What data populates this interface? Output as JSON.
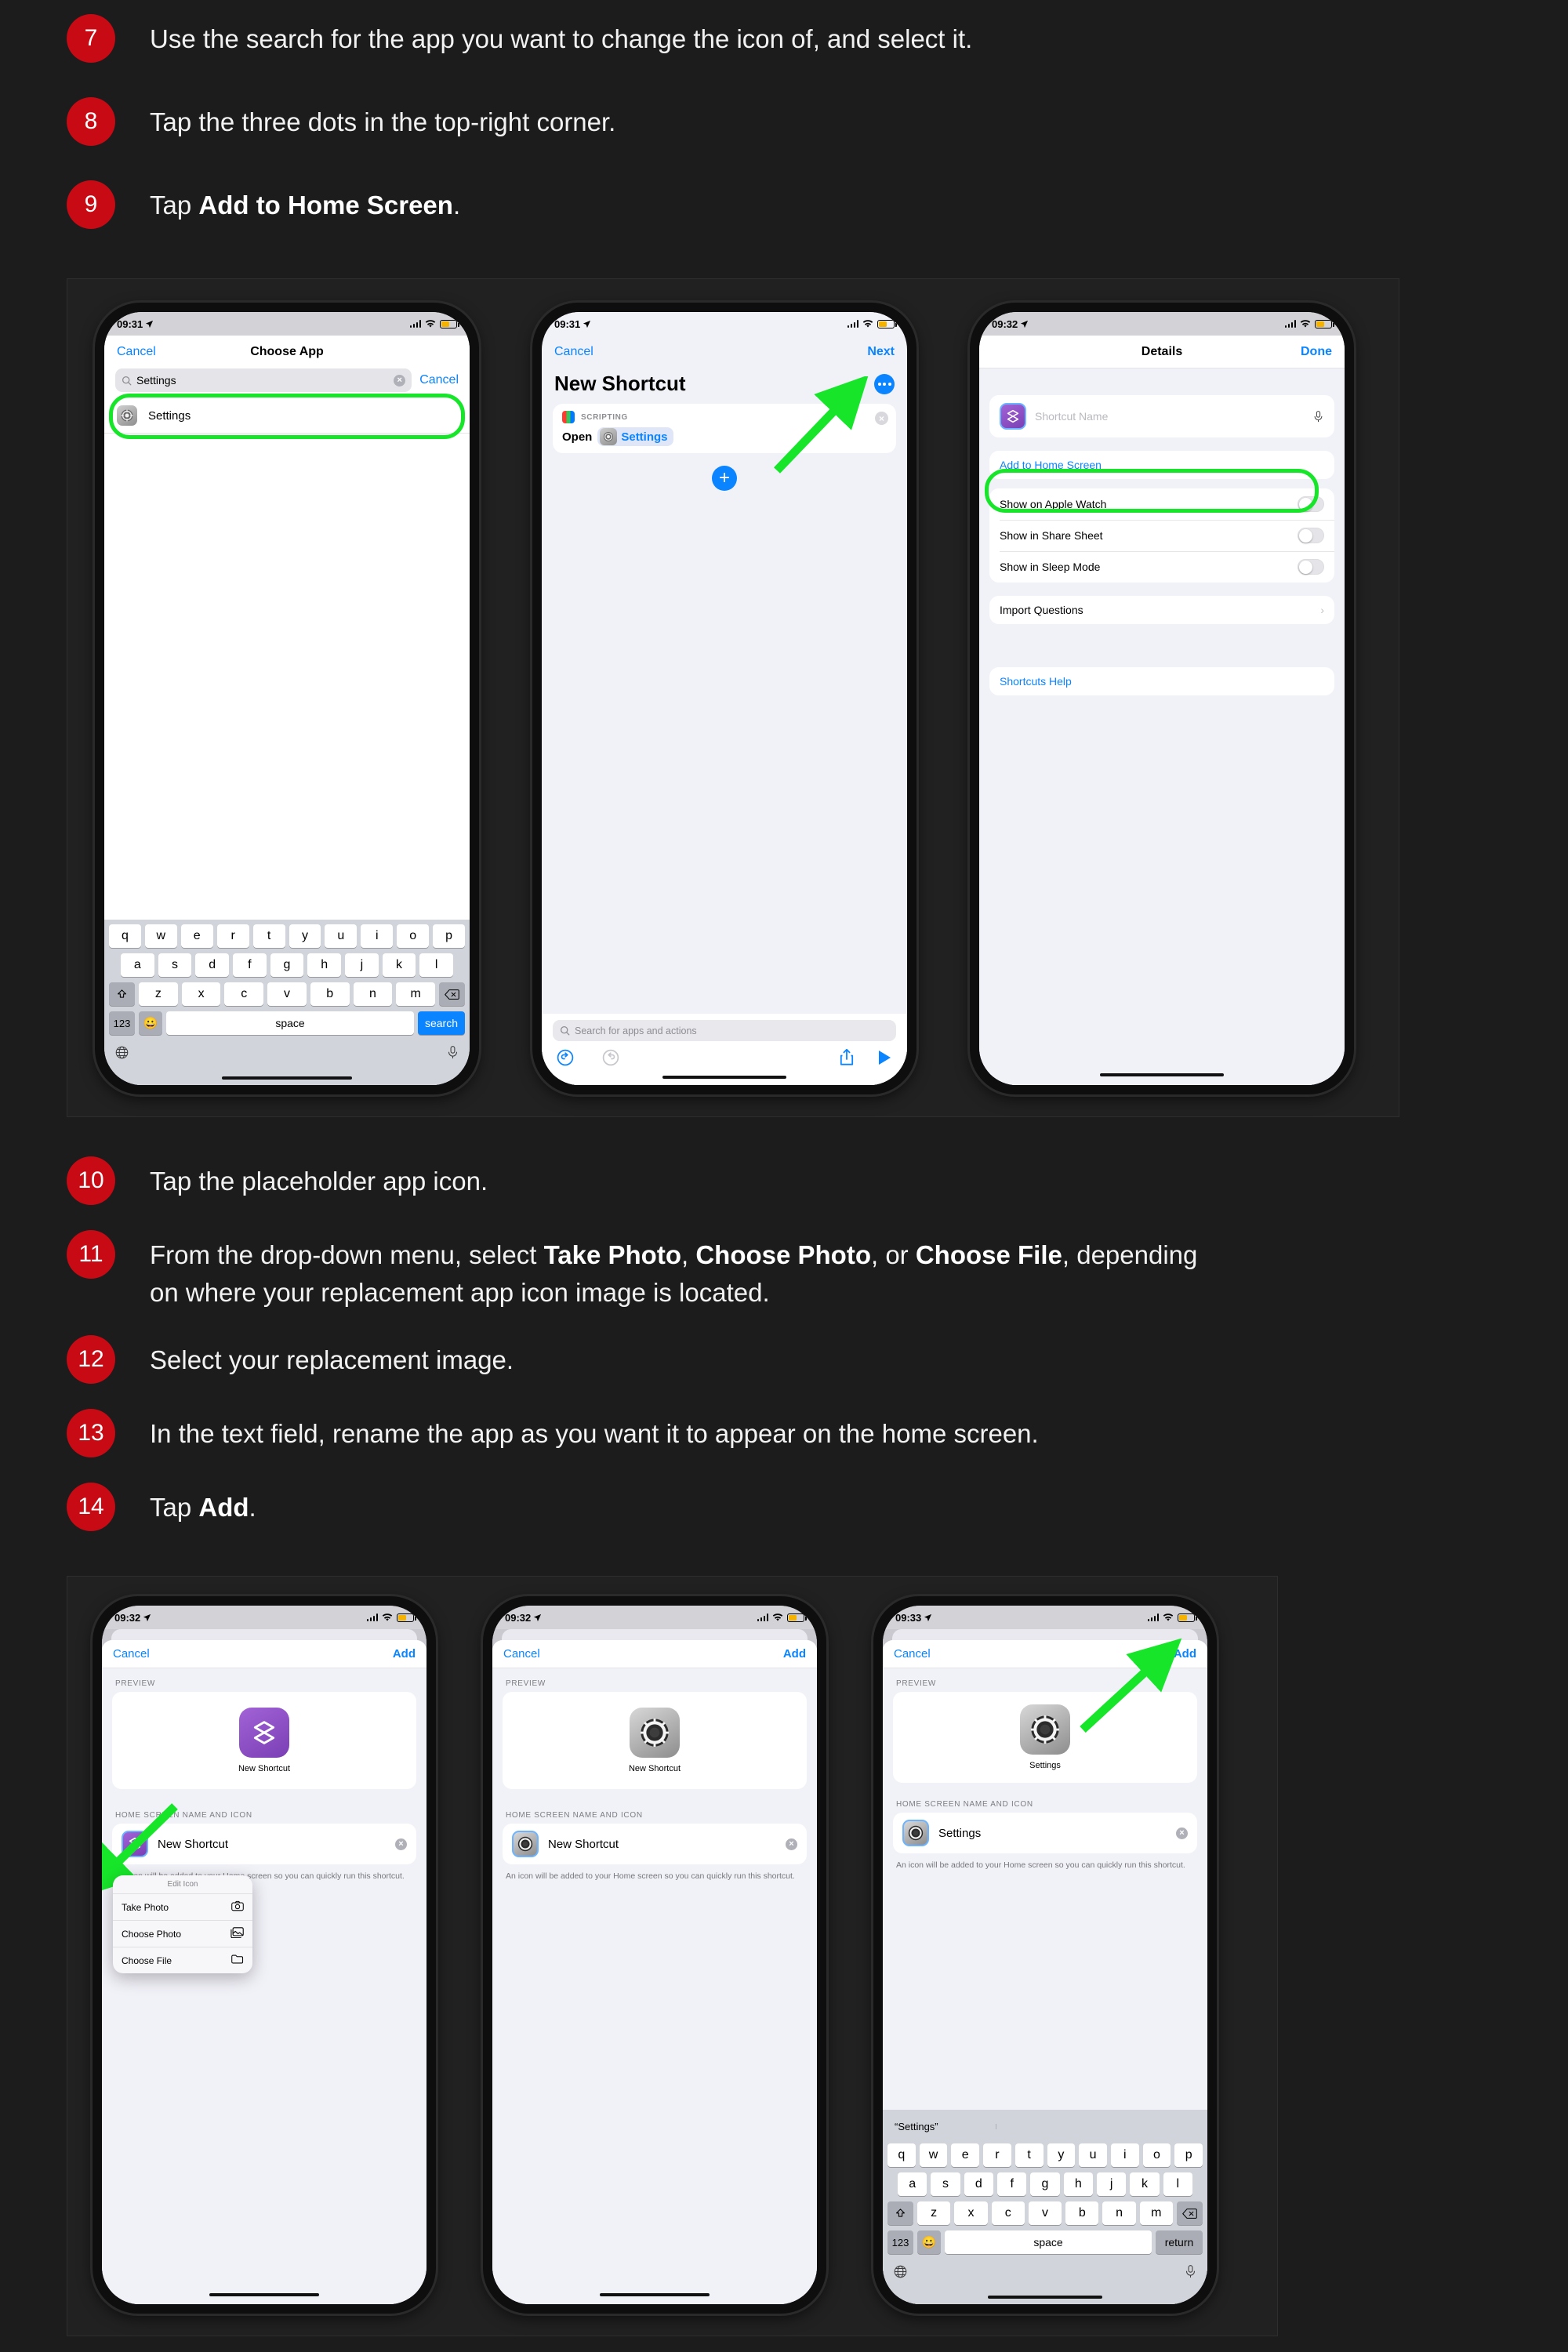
{
  "steps_top": [
    {
      "num": "7",
      "parts": [
        {
          "t": "Use the search for the app you want to change the icon of, and select it.",
          "b": false
        }
      ]
    },
    {
      "num": "8",
      "parts": [
        {
          "t": "Tap the three dots in the top-right corner.",
          "b": false
        }
      ]
    },
    {
      "num": "9",
      "parts": [
        {
          "t": "Tap ",
          "b": false
        },
        {
          "t": "Add to Home Screen",
          "b": true
        },
        {
          "t": ".",
          "b": false
        }
      ]
    }
  ],
  "steps_bottom": [
    {
      "num": "10",
      "parts": [
        {
          "t": "Tap the placeholder app icon.",
          "b": false
        }
      ]
    },
    {
      "num": "11",
      "parts": [
        {
          "t": "From the drop-down menu, select ",
          "b": false
        },
        {
          "t": "Take Photo",
          "b": true
        },
        {
          "t": ", ",
          "b": false
        },
        {
          "t": "Choose Photo",
          "b": true
        },
        {
          "t": ", or ",
          "b": false
        },
        {
          "t": "Choose File",
          "b": true
        },
        {
          "t": ", depending on where your replacement app icon image is located.",
          "b": false
        }
      ]
    },
    {
      "num": "12",
      "parts": [
        {
          "t": "Select your replacement image.",
          "b": false
        }
      ]
    },
    {
      "num": "13",
      "parts": [
        {
          "t": "In the text field, rename the app as you want it to appear on the home screen.",
          "b": false
        }
      ]
    },
    {
      "num": "14",
      "parts": [
        {
          "t": "Tap ",
          "b": false
        },
        {
          "t": "Add",
          "b": true
        },
        {
          "t": ".",
          "b": false
        }
      ]
    }
  ],
  "colors": {
    "badge_red": "#c80a14",
    "ios_blue": "#0a84ff",
    "highlight_green": "#17e52a",
    "page_bg": "#1c1c1c",
    "group_bg": "#212121"
  },
  "phone1": {
    "status": {
      "time": "09:31",
      "battery": "55"
    },
    "nav": {
      "cancel": "Cancel",
      "title": "Choose App"
    },
    "search": {
      "value": "Settings",
      "cancel": "Cancel",
      "clear_icon": "clear-circle-icon",
      "search_icon": "search-icon"
    },
    "result": {
      "label": "Settings",
      "icon": "settings-gear-icon"
    },
    "keyboard": {
      "row1": [
        "q",
        "w",
        "e",
        "r",
        "t",
        "y",
        "u",
        "i",
        "o",
        "p"
      ],
      "row2": [
        "a",
        "s",
        "d",
        "f",
        "g",
        "h",
        "j",
        "k",
        "l"
      ],
      "row3": [
        "z",
        "x",
        "c",
        "v",
        "b",
        "n",
        "m"
      ],
      "shift": "shift-icon",
      "backspace": "backspace-icon",
      "num": "123",
      "emoji": "emoji-icon",
      "space": "space",
      "action": "search",
      "globe": "globe-icon",
      "mic": "microphone-icon"
    }
  },
  "phone2": {
    "status": {
      "time": "09:31",
      "battery": "55"
    },
    "nav": {
      "cancel": "Cancel",
      "next": "Next"
    },
    "title": "New Shortcut",
    "more_button": "more-dots-icon",
    "action_card": {
      "category": "SCRIPTING",
      "verb": "Open",
      "token": "Settings",
      "close": "close-circle-icon"
    },
    "add_action_button": "plus-icon",
    "bottom_search_placeholder": "Search for apps and actions",
    "toolbar": {
      "undo": "undo-icon",
      "redo": "redo-icon",
      "share": "share-icon",
      "play": "play-icon"
    }
  },
  "phone3": {
    "status": {
      "time": "09:32",
      "battery": "55"
    },
    "nav": {
      "title": "Details",
      "done": "Done"
    },
    "name_field": {
      "placeholder": "Shortcut Name",
      "icon": "shortcut-layers-icon",
      "mic": "microphone-icon"
    },
    "add_to_home": "Add to Home Screen",
    "toggles": [
      {
        "label": "Show on Apple Watch",
        "on": false
      },
      {
        "label": "Show in Share Sheet",
        "on": false
      },
      {
        "label": "Show in Sleep Mode",
        "on": false
      }
    ],
    "import_questions": {
      "label": "Import Questions",
      "chevron": "chevron-right-icon"
    },
    "shortcuts_help": "Shortcuts Help"
  },
  "phone4": {
    "status": {
      "time": "09:32",
      "battery": "55"
    },
    "sheet_nav": {
      "cancel": "Cancel",
      "add": "Add"
    },
    "preview_label": "PREVIEW",
    "preview": {
      "name": "New Shortcut",
      "icon": "shortcut-layers-icon"
    },
    "home_label": "HOME SCREEN NAME AND ICON",
    "home_row": {
      "name": "New Shortcut",
      "icon": "shortcut-layers-icon",
      "clear": "clear-circle-icon"
    },
    "note": "An icon will be added to your Home screen so you can quickly run this shortcut.",
    "menu": {
      "title": "Edit Icon",
      "items": [
        {
          "label": "Take Photo",
          "icon": "camera-icon"
        },
        {
          "label": "Choose Photo",
          "icon": "photos-icon"
        },
        {
          "label": "Choose File",
          "icon": "folder-icon"
        }
      ]
    }
  },
  "phone5": {
    "status": {
      "time": "09:32",
      "battery": "55"
    },
    "sheet_nav": {
      "cancel": "Cancel",
      "add": "Add"
    },
    "preview_label": "PREVIEW",
    "preview": {
      "name": "New Shortcut",
      "icon": "settings-gear-icon"
    },
    "home_label": "HOME SCREEN NAME AND ICON",
    "home_row": {
      "name": "New Shortcut",
      "icon": "settings-gear-icon",
      "clear": "clear-circle-icon"
    },
    "note": "An icon will be added to your Home screen so you can quickly run this shortcut."
  },
  "phone6": {
    "status": {
      "time": "09:33",
      "battery": "55"
    },
    "sheet_nav": {
      "cancel": "Cancel",
      "add": "Add"
    },
    "preview_label": "PREVIEW",
    "preview": {
      "name": "Settings",
      "icon": "settings-gear-icon"
    },
    "home_label": "HOME SCREEN NAME AND ICON",
    "home_row": {
      "name": "Settings",
      "icon": "settings-gear-icon",
      "clear": "clear-circle-icon"
    },
    "note": "An icon will be added to your Home screen so you can quickly run this shortcut.",
    "keyboard": {
      "suggestion": "“Settings”",
      "row1": [
        "q",
        "w",
        "e",
        "r",
        "t",
        "y",
        "u",
        "i",
        "o",
        "p"
      ],
      "row2": [
        "a",
        "s",
        "d",
        "f",
        "g",
        "h",
        "j",
        "k",
        "l"
      ],
      "row3": [
        "z",
        "x",
        "c",
        "v",
        "b",
        "n",
        "m"
      ],
      "shift": "shift-icon",
      "backspace": "backspace-icon",
      "num": "123",
      "emoji": "emoji-icon",
      "space": "space",
      "action": "return",
      "globe": "globe-icon",
      "mic": "microphone-icon"
    }
  }
}
